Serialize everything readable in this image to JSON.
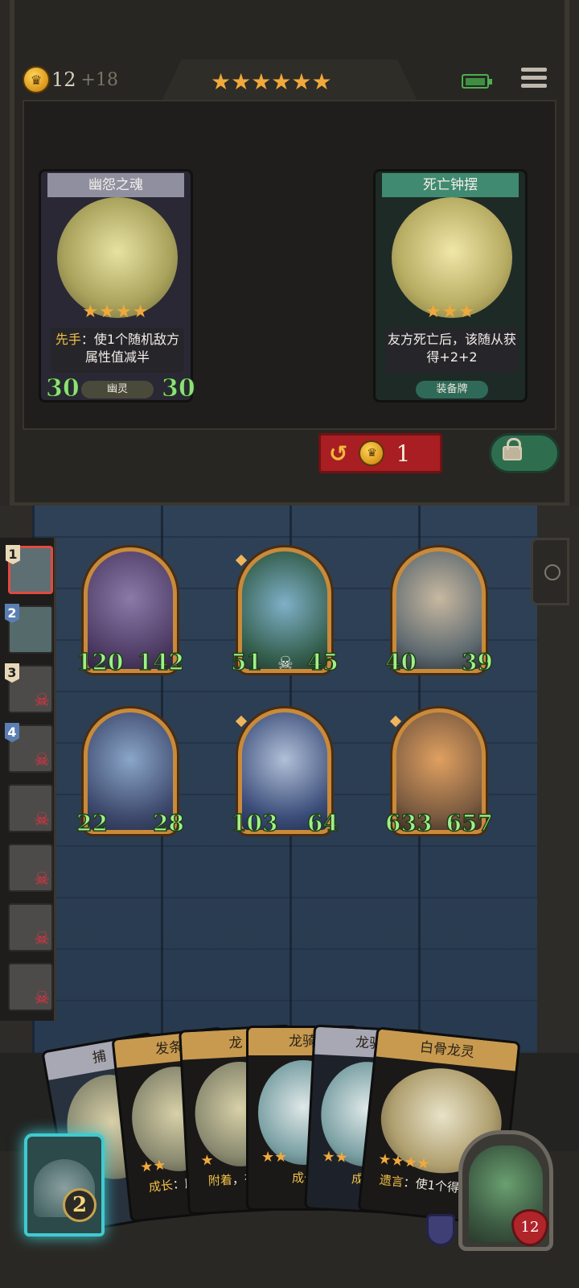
{
  "header": {
    "gold": "12",
    "gold_income": "+18",
    "tier_stars": "★★★★★★"
  },
  "shop": {
    "cards": [
      {
        "name": "幽怨之魂",
        "stars": "★★★★",
        "desc_keyword": "先手",
        "desc": "：使1个随机敌方属性值减半",
        "tag": "幽灵",
        "attack": "30",
        "health": "30"
      },
      {
        "name": "死亡钟摆",
        "stars": "★★★",
        "desc": "友方死亡后，该随从获得+2+2",
        "tag": "装备牌"
      }
    ],
    "reroll_cost": "1"
  },
  "board": {
    "minions": [
      {
        "attack": "120",
        "health": "142"
      },
      {
        "attack": "51",
        "health": "45"
      },
      {
        "attack": "40",
        "health": "39"
      },
      {
        "attack": "22",
        "health": "28"
      },
      {
        "attack": "103",
        "health": "64"
      },
      {
        "attack": "633",
        "health": "657"
      }
    ]
  },
  "order": {
    "slots": [
      {
        "num": "1"
      },
      {
        "num": "2"
      },
      {
        "num": "3"
      },
      {
        "num": "4"
      },
      {
        "num": ""
      },
      {
        "num": ""
      },
      {
        "num": ""
      },
      {
        "num": ""
      }
    ]
  },
  "hand": {
    "cards": [
      {
        "name": "捕",
        "stars": "",
        "desc": ""
      },
      {
        "name": "发条",
        "stars": "★★",
        "desc_keyword": "成长",
        "desc": "：所有随"
      },
      {
        "name": "龙",
        "stars": "★",
        "desc_keyword": "附着",
        "desc": "，有友方"
      },
      {
        "name": "龙骑",
        "stars": "★★",
        "desc_keyword": "成长",
        "desc": ""
      },
      {
        "name": "龙骑",
        "stars": "★★",
        "desc_keyword": "成长",
        "desc": ""
      },
      {
        "name": "白骨龙灵",
        "stars": "★★★★",
        "desc_keyword": "遗言",
        "desc": "：使1个得该随"
      }
    ]
  },
  "hero": {
    "health": "12"
  },
  "hero_power": {
    "cost": "2"
  }
}
